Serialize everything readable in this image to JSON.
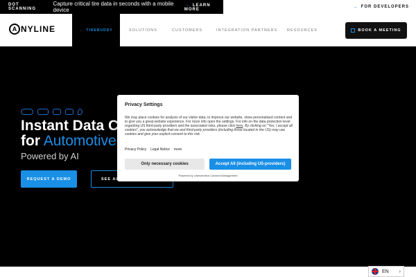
{
  "topbar": {
    "tag": "DOT SCANNING",
    "message": "Capture critical tire data in seconds with a mobile device",
    "learn_more": "LEARN MORE",
    "developers": "FOR DEVELOPERS"
  },
  "nav": {
    "logo_text": "NYLINE",
    "logo_letter": "A",
    "active_item": "TIREBUDDY",
    "items": [
      "SOLUTIONS",
      "CUSTOMERS",
      "INTEGRATION PARTNERS",
      "RESOURCES"
    ],
    "book_meeting": "BOOK A MEETING"
  },
  "hero": {
    "title_line1": "Instant Data Ca",
    "title_line2_white": "for",
    "title_line2_blue": "Automotive",
    "subtitle": "Powered by AI",
    "primary_button": "REQUEST A DEMO",
    "secondary_button": "SEE AU"
  },
  "language": {
    "code": "EN"
  },
  "privacy_dialog": {
    "title": "Privacy Settings",
    "body_1": "We may place cookies for analysis of our visitor data, to improve our website, show personalised content and to give you a great website experience. For more info open the settings. For info on the data protection level regarding US third-party providers and the associated risks, please click ",
    "body_link": "here",
    "body_2": ". By clicking on \"Yes, I accept all cookies\", you acknowledge that we and third-party providers (including those located in the US) may use cookies and give your explicit consent to this risk.",
    "links": [
      "Privacy Policy",
      "Legal Notice",
      "more"
    ],
    "btn_necessary": "Only necessary cookies",
    "btn_accept": "Accept All (including US-providers)",
    "powered_by": "Powered by Usercentrics Consent Management"
  },
  "colors": {
    "accent": "#1a8fe6",
    "background": "#000000"
  }
}
